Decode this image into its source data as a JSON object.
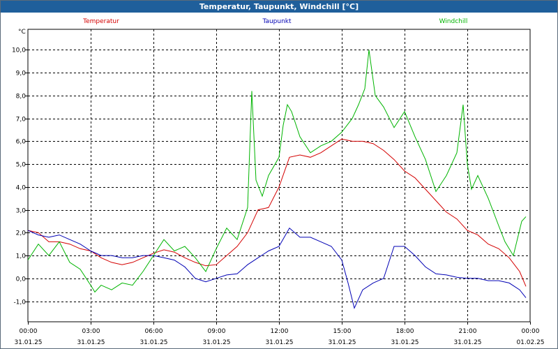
{
  "window": {
    "title": "Temperatur, Taupunkt, Windchill [°C]",
    "titlebar_color": "#1f5f9b"
  },
  "chart_data": {
    "type": "line",
    "title": "Temperatur, Taupunkt, Windchill [°C]",
    "ylabel": "°C",
    "xlabel": "",
    "ylim": [
      -1.9,
      10.9
    ],
    "xlim": [
      0,
      24
    ],
    "grid": true,
    "y_ticks": [
      -1.0,
      0.0,
      1.0,
      2.0,
      3.0,
      4.0,
      5.0,
      6.0,
      7.0,
      8.0,
      9.0,
      10.0
    ],
    "y_tick_labels": [
      "-1,0",
      "0,0",
      "1,0",
      "2,0",
      "3,0",
      "4,0",
      "5,0",
      "6,0",
      "7,0",
      "8,0",
      "9,0",
      "10,0"
    ],
    "x_ticks": [
      0,
      3,
      6,
      9,
      12,
      15,
      18,
      21,
      24
    ],
    "x_tick_time_labels": [
      "00:00",
      "03:00",
      "06:00",
      "09:00",
      "12:00",
      "15:00",
      "18:00",
      "21:00",
      "00:00"
    ],
    "x_tick_date_labels": [
      "31.01.25",
      "31.01.25",
      "31.01.25",
      "31.01.25",
      "31.01.25",
      "31.01.25",
      "31.01.25",
      "31.01.25",
      "01.02.25"
    ],
    "series": [
      {
        "name": "Temperatur",
        "color": "#d40000",
        "x": [
          0,
          0.5,
          1,
          1.5,
          2,
          2.5,
          3,
          3.5,
          4,
          4.5,
          5,
          5.5,
          6,
          6.5,
          7,
          7.5,
          8,
          8.5,
          9,
          9.5,
          10,
          10.5,
          11,
          11.5,
          12,
          12.5,
          13,
          13.5,
          14,
          14.5,
          15,
          15.5,
          16,
          16.5,
          17,
          17.5,
          18,
          18.5,
          19,
          19.5,
          20,
          20.5,
          21,
          21.5,
          22,
          22.5,
          23,
          23.5,
          23.8
        ],
        "y": [
          2.1,
          2.0,
          1.6,
          1.6,
          1.5,
          1.3,
          1.2,
          0.9,
          0.7,
          0.6,
          0.7,
          0.9,
          1.1,
          1.25,
          1.15,
          0.9,
          0.7,
          0.55,
          0.6,
          1.0,
          1.4,
          2.0,
          3.0,
          3.1,
          4.0,
          5.3,
          5.4,
          5.3,
          5.5,
          5.8,
          6.1,
          6.0,
          6.0,
          5.9,
          5.6,
          5.2,
          4.7,
          4.4,
          3.9,
          3.4,
          2.9,
          2.6,
          2.1,
          1.9,
          1.5,
          1.3,
          0.9,
          0.3,
          -0.35
        ]
      },
      {
        "name": "Taupunkt",
        "color": "#0000b4",
        "x": [
          0,
          0.5,
          1,
          1.5,
          2,
          2.5,
          3,
          3.5,
          4,
          4.5,
          5,
          5.5,
          6,
          6.5,
          7,
          7.5,
          8,
          8.5,
          9,
          9.5,
          10,
          10.5,
          11,
          11.5,
          12,
          12.5,
          13,
          13.5,
          14,
          14.5,
          15,
          15.3,
          15.6,
          16,
          16.5,
          17,
          17.5,
          18,
          18.5,
          19,
          19.5,
          20,
          20.5,
          21,
          21.5,
          22,
          22.5,
          23,
          23.5,
          23.8
        ],
        "y": [
          2.1,
          1.9,
          1.8,
          1.9,
          1.7,
          1.5,
          1.2,
          1.0,
          1.0,
          0.9,
          0.9,
          1.0,
          1.0,
          0.9,
          0.8,
          0.5,
          0.0,
          -0.15,
          0.0,
          0.15,
          0.2,
          0.6,
          0.9,
          1.2,
          1.4,
          2.2,
          1.8,
          1.8,
          1.6,
          1.4,
          0.8,
          -0.2,
          -1.3,
          -0.5,
          -0.2,
          0.0,
          1.4,
          1.4,
          1.0,
          0.5,
          0.2,
          0.15,
          0.05,
          0.0,
          0.0,
          -0.1,
          -0.1,
          -0.2,
          -0.5,
          -0.85
        ]
      },
      {
        "name": "Windchill",
        "color": "#00b400",
        "x": [
          0,
          0.5,
          1,
          1.5,
          2,
          2.5,
          3,
          3.2,
          3.5,
          4,
          4.5,
          5,
          5.5,
          6,
          6.5,
          7,
          7.5,
          8,
          8.5,
          9,
          9.5,
          10,
          10.5,
          10.7,
          10.9,
          11.2,
          11.5,
          12,
          12.2,
          12.4,
          12.6,
          13,
          13.5,
          14,
          14.5,
          15,
          15.5,
          15.8,
          16.1,
          16.3,
          16.6,
          17,
          17.5,
          18,
          18.5,
          19,
          19.5,
          20,
          20.5,
          20.8,
          21,
          21.2,
          21.5,
          22,
          22.5,
          22.8,
          23.2,
          23.6,
          23.8
        ],
        "y": [
          0.8,
          1.5,
          1.0,
          1.6,
          0.7,
          0.4,
          -0.3,
          -0.6,
          -0.3,
          -0.5,
          -0.2,
          -0.3,
          0.3,
          1.0,
          1.7,
          1.2,
          1.4,
          0.9,
          0.3,
          1.3,
          2.2,
          1.7,
          3.1,
          8.2,
          4.3,
          3.6,
          4.5,
          5.3,
          6.7,
          7.6,
          7.3,
          6.2,
          5.5,
          5.8,
          6.0,
          6.4,
          7.0,
          7.6,
          8.3,
          10.0,
          8.0,
          7.5,
          6.6,
          7.3,
          6.2,
          5.2,
          3.8,
          4.5,
          5.5,
          7.6,
          5.0,
          3.9,
          4.5,
          3.5,
          2.3,
          1.6,
          1.0,
          2.5,
          2.7
        ]
      }
    ]
  }
}
